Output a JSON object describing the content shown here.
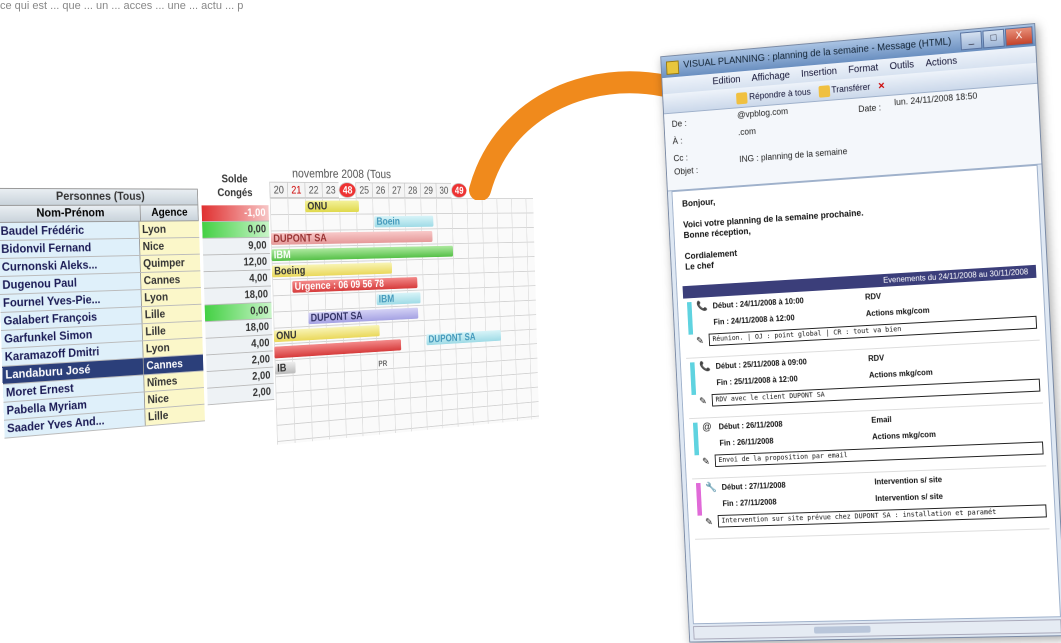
{
  "top_text": "ce qui est ... que ... un ... acces ... une ... actu ... p",
  "planning": {
    "persons_header": "Personnes (Tous)",
    "col_name": "Nom-Prénom",
    "col_agency": "Agence",
    "persons": [
      {
        "name": "Baudel Frédéric",
        "agency": "Lyon"
      },
      {
        "name": "Bidonvil Fernand",
        "agency": "Nice"
      },
      {
        "name": "Curnonski Aleks...",
        "agency": "Quimper"
      },
      {
        "name": "Dugenou Paul",
        "agency": "Cannes"
      },
      {
        "name": "Fournel Yves-Pie...",
        "agency": "Lyon"
      },
      {
        "name": "Galabert François",
        "agency": "Lille"
      },
      {
        "name": "Garfunkel Simon",
        "agency": "Lille"
      },
      {
        "name": "Karamazoff Dmitri",
        "agency": "Lyon"
      },
      {
        "name": "Landaburu José",
        "agency": "Cannes"
      },
      {
        "name": "Moret Ernest",
        "agency": "Nîmes"
      },
      {
        "name": "Pabella Myriam",
        "agency": "Nice"
      },
      {
        "name": "Saader Yves And...",
        "agency": "Lille"
      }
    ],
    "solde_header_1": "Solde",
    "solde_header_2": "Congés",
    "soldes": [
      "-1,00",
      "0,00",
      "9,00",
      "12,00",
      "4,00",
      "18,00",
      "0,00",
      "18,00",
      "4,00",
      "2,00",
      "2,00",
      "2,00"
    ],
    "month": "novembre 2008 (Tous",
    "days": [
      "20",
      "21",
      "22",
      "23",
      "48",
      "25",
      "26",
      "27",
      "28",
      "29",
      "30",
      "49"
    ],
    "bars": {
      "onu": "ONU",
      "boeing_short": "Boein",
      "dupont": "DUPONT SA",
      "ibm": "IBM",
      "boeing": "Boeing",
      "urgence": "Urgence : 06 09 56 78",
      "ibm2": "IBM",
      "dupont2": "DUPONT SA",
      "onu2": "ONU",
      "dupont3": "DUPONT SA",
      "ib": "IB",
      "pr": "PR"
    }
  },
  "mail": {
    "title": "VISUAL PLANNING : planning de la semaine - Message (HTML)",
    "menus": [
      "Edition",
      "Affichage",
      "Insertion",
      "Format",
      "Outils",
      "Actions"
    ],
    "toolbar": [
      "Répondre à tous",
      "Transférer"
    ],
    "from_label": "De :",
    "from_value": "@vpblog.com",
    "to_label": "À :",
    "to_value": ".com",
    "cc_label": "Cc :",
    "subject_label": "Objet :",
    "subject_value": "ING : planning de la semaine",
    "date_label": "Date :",
    "date_value": "lun. 24/11/2008 18:50",
    "greeting": "Bonjour,",
    "body_1": "Voici votre planning de la semaine prochaine.",
    "body_2": "Bonne réception,",
    "closing_1": "Cordialement",
    "closing_2": "Le chef",
    "events_header": "Evenements du 24/11/2008 au 30/11/2008",
    "events": [
      {
        "start": "Début : 24/11/2008 à 10:00",
        "end": "Fin : 24/11/2008 à 12:00",
        "type": "RDV",
        "cat": "Actions mkg/com",
        "memo": "Réunion. | OJ : point global | CR : tout va bien",
        "color": "#5fd3e0"
      },
      {
        "start": "Début : 25/11/2008 à 09:00",
        "end": "Fin : 25/11/2008 à 12:00",
        "type": "RDV",
        "cat": "Actions mkg/com",
        "memo": "RDV avec le client DUPONT SA",
        "color": "#5fd3e0"
      },
      {
        "start": "Début : 26/11/2008",
        "end": "Fin : 26/11/2008",
        "type": "Email",
        "cat": "Actions mkg/com",
        "memo": "Envoi de la proposition par email",
        "color": "#5fd3e0"
      },
      {
        "start": "Début : 27/11/2008",
        "end": "Fin : 27/11/2008",
        "type": "Intervention s/ site",
        "cat": "Intervention s/ site",
        "memo": "Intervention sur site prévue chez DUPONT SA : installation et paramét",
        "color": "#e06ad8"
      }
    ]
  },
  "colors": {
    "arrow": "#f08a1c",
    "selected_row": "#2b3f7a",
    "events_header": "#3b3e7a"
  }
}
